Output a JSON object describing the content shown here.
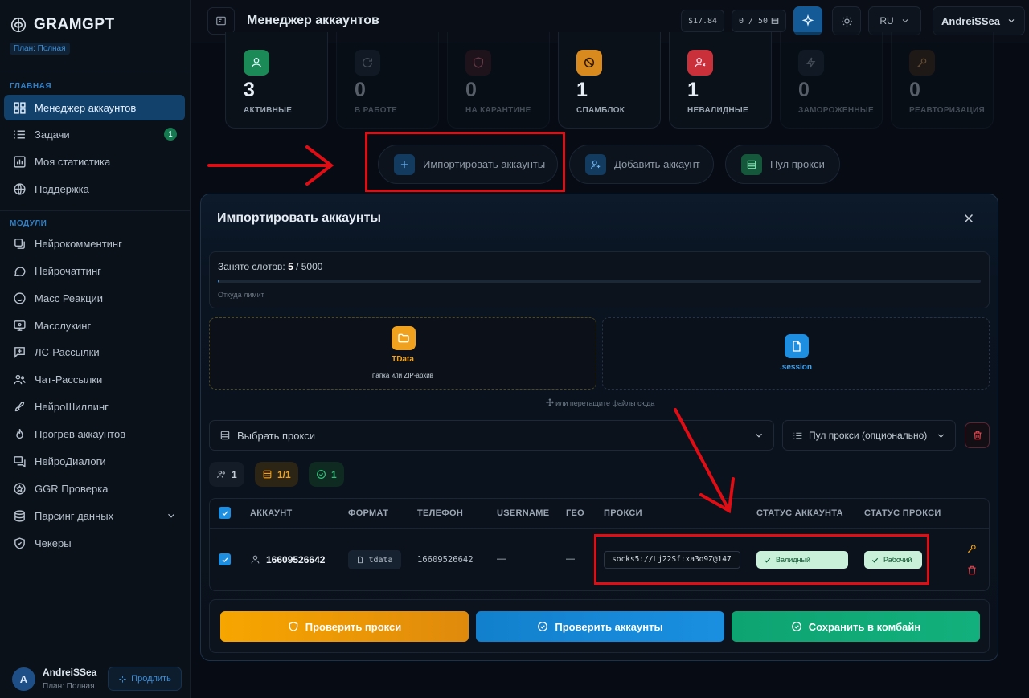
{
  "brand": {
    "name": "GRAMGPT",
    "plan_tag": "План: Полная"
  },
  "sidebar": {
    "section_main": "ГЛАВНАЯ",
    "main_items": [
      {
        "label": "Менеджер аккаунтов",
        "icon": "grid-icon"
      },
      {
        "label": "Задачи",
        "icon": "list-icon",
        "badge": "1"
      },
      {
        "label": "Моя статистика",
        "icon": "chart-icon"
      },
      {
        "label": "Поддержка",
        "icon": "globe-icon"
      }
    ],
    "section_modules": "МОДУЛИ",
    "module_items": [
      {
        "label": "Нейрокомментинг",
        "icon": "layers-icon"
      },
      {
        "label": "Нейрочаттинг",
        "icon": "chat-icon"
      },
      {
        "label": "Масс Реакции",
        "icon": "smile-icon"
      },
      {
        "label": "Масслукинг",
        "icon": "monitor-icon"
      },
      {
        "label": "ЛС-Рассылки",
        "icon": "message-plus-icon"
      },
      {
        "label": "Чат-Рассылки",
        "icon": "users-icon"
      },
      {
        "label": "НейроШиллинг",
        "icon": "rocket-icon"
      },
      {
        "label": "Прогрев аккаунтов",
        "icon": "flame-icon"
      },
      {
        "label": "НейроДиалоги",
        "icon": "dialog-icon"
      },
      {
        "label": "GGR Проверка",
        "icon": "star-icon"
      },
      {
        "label": "Парсинг данных",
        "icon": "database-icon"
      },
      {
        "label": "Чекеры",
        "icon": "shield-check-icon"
      }
    ],
    "user": {
      "initial": "A",
      "name": "AndreiSSea",
      "plan": "План: Полная",
      "extend": "Продлить"
    }
  },
  "header": {
    "title": "Менеджер аккаунтов",
    "balance": "$17.84",
    "slots": "0 / 50",
    "lang": "RU",
    "user": "AndreiSSea"
  },
  "stats": [
    {
      "value": "3",
      "label": "АКТИВНЫЕ",
      "color": "#2fbf7a",
      "icon": "user-icon"
    },
    {
      "value": "0",
      "label": "В РАБОТЕ",
      "color": "#5e6f82",
      "icon": "refresh-icon"
    },
    {
      "value": "0",
      "label": "НА КАРАНТИНЕ",
      "color": "#7a4a55",
      "icon": "shield-icon"
    },
    {
      "value": "1",
      "label": "СПАМБЛОК",
      "color": "#f2a33a",
      "icon": "ban-icon"
    },
    {
      "value": "1",
      "label": "НЕВАЛИДНЫЕ",
      "color": "#e0424a",
      "icon": "user-x-icon"
    },
    {
      "value": "0",
      "label": "ЗАМОРОЖЕННЫЕ",
      "color": "#4f6070",
      "icon": "bolt-icon"
    },
    {
      "value": "0",
      "label": "РЕАВТОРИЗАЦИЯ",
      "color": "#7a5a3a",
      "icon": "key-icon"
    }
  ],
  "actions": {
    "import": "Импортировать аккаунты",
    "add": "Добавить аккаунт",
    "proxy_pool": "Пул прокси"
  },
  "modal": {
    "title": "Импортировать аккаунты",
    "slots_label": "Занято слотов:",
    "slots_used": "5",
    "slots_total": "/ 5000",
    "slots_fraction": 0.001,
    "limit_link": "Откуда лимит",
    "drop_tdata_title": "TData",
    "drop_tdata_sub": "папка или ZIP-архив",
    "drop_session_title": ".session",
    "drag_hint": "или перетащите файлы сюда",
    "proxy_select": "Выбрать прокси",
    "proxy_pool_select": "Пул прокси (опционально)",
    "counters": {
      "users": "1",
      "proxies": "1/1",
      "valid": "1"
    },
    "columns": [
      "АККАУНТ",
      "ФОРМАТ",
      "ТЕЛЕФОН",
      "USERNAME",
      "ГЕО",
      "ПРОКСИ",
      "СТАТУС АККАУНТА",
      "СТАТУС ПРОКСИ"
    ],
    "row": {
      "account": "16609526642",
      "format": "tdata",
      "phone": "16609526642",
      "username": "—",
      "geo": "—",
      "proxy": "socks5://Lj22Sf:xa3o9Z@147",
      "account_status": "Валидный",
      "proxy_status": "Рабочий"
    },
    "buttons": {
      "check_proxy": "Проверить прокси",
      "check_accounts": "Проверить аккаунты",
      "save": "Сохранить в комбайн"
    }
  },
  "colors": {
    "accent": "#1d8ee0",
    "sidebar_active": "#12416c",
    "annotation": "#e00d14"
  }
}
